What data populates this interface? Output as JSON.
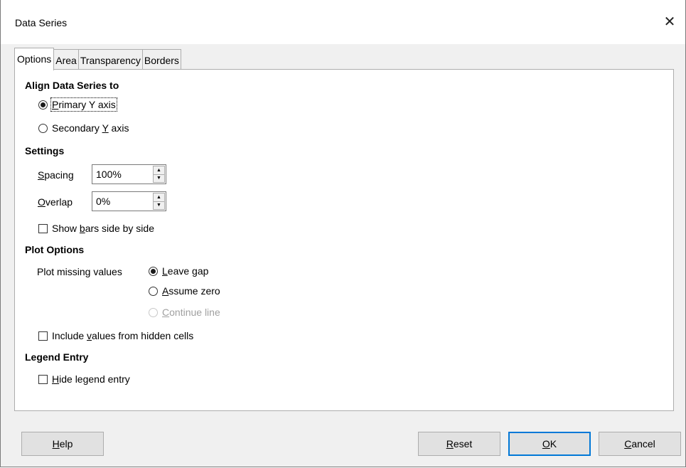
{
  "window": {
    "title": "Data Series",
    "close_glyph": "✕"
  },
  "tabs": [
    {
      "label": "Options"
    },
    {
      "label": "Area"
    },
    {
      "label": "Transparency"
    },
    {
      "label": "Borders"
    }
  ],
  "align": {
    "heading": "Align Data Series to",
    "primary": {
      "pre": "",
      "key": "P",
      "post": "rimary Y axis",
      "checked": true
    },
    "secondary": {
      "pre": "Secondary ",
      "key": "Y",
      "post": " axis",
      "checked": false
    }
  },
  "settings": {
    "heading": "Settings",
    "spacing": {
      "key": "S",
      "post": "pacing",
      "value": "100%"
    },
    "overlap": {
      "key": "O",
      "post": "verlap",
      "value": "0%"
    },
    "side_by_side": {
      "pre": "Show ",
      "key": "b",
      "post": "ars side by side",
      "checked": false
    }
  },
  "plot": {
    "heading": "Plot Options",
    "missing_label": "Plot missing values",
    "leave_gap": {
      "key": "L",
      "post": "eave gap",
      "checked": true
    },
    "assume_zero": {
      "key": "A",
      "post": "ssume zero",
      "checked": false
    },
    "continue_line": {
      "key": "C",
      "post": "ontinue line",
      "checked": false,
      "disabled": true
    },
    "hidden_cells": {
      "pre": "Include ",
      "key": "v",
      "post": "alues from hidden cells",
      "checked": false
    }
  },
  "legend": {
    "heading": "Legend Entry",
    "hide": {
      "key": "H",
      "post": "ide legend entry",
      "checked": false
    }
  },
  "buttons": {
    "help": {
      "key": "H",
      "post": "elp"
    },
    "reset": {
      "key": "R",
      "post": "eset"
    },
    "ok": {
      "key": "O",
      "post": "K"
    },
    "cancel": {
      "key": "C",
      "post": "ancel"
    }
  },
  "colors": {
    "default_button_border": "#0078d7",
    "panel_background": "#ffffff",
    "dialog_background": "#f0f0f0"
  }
}
